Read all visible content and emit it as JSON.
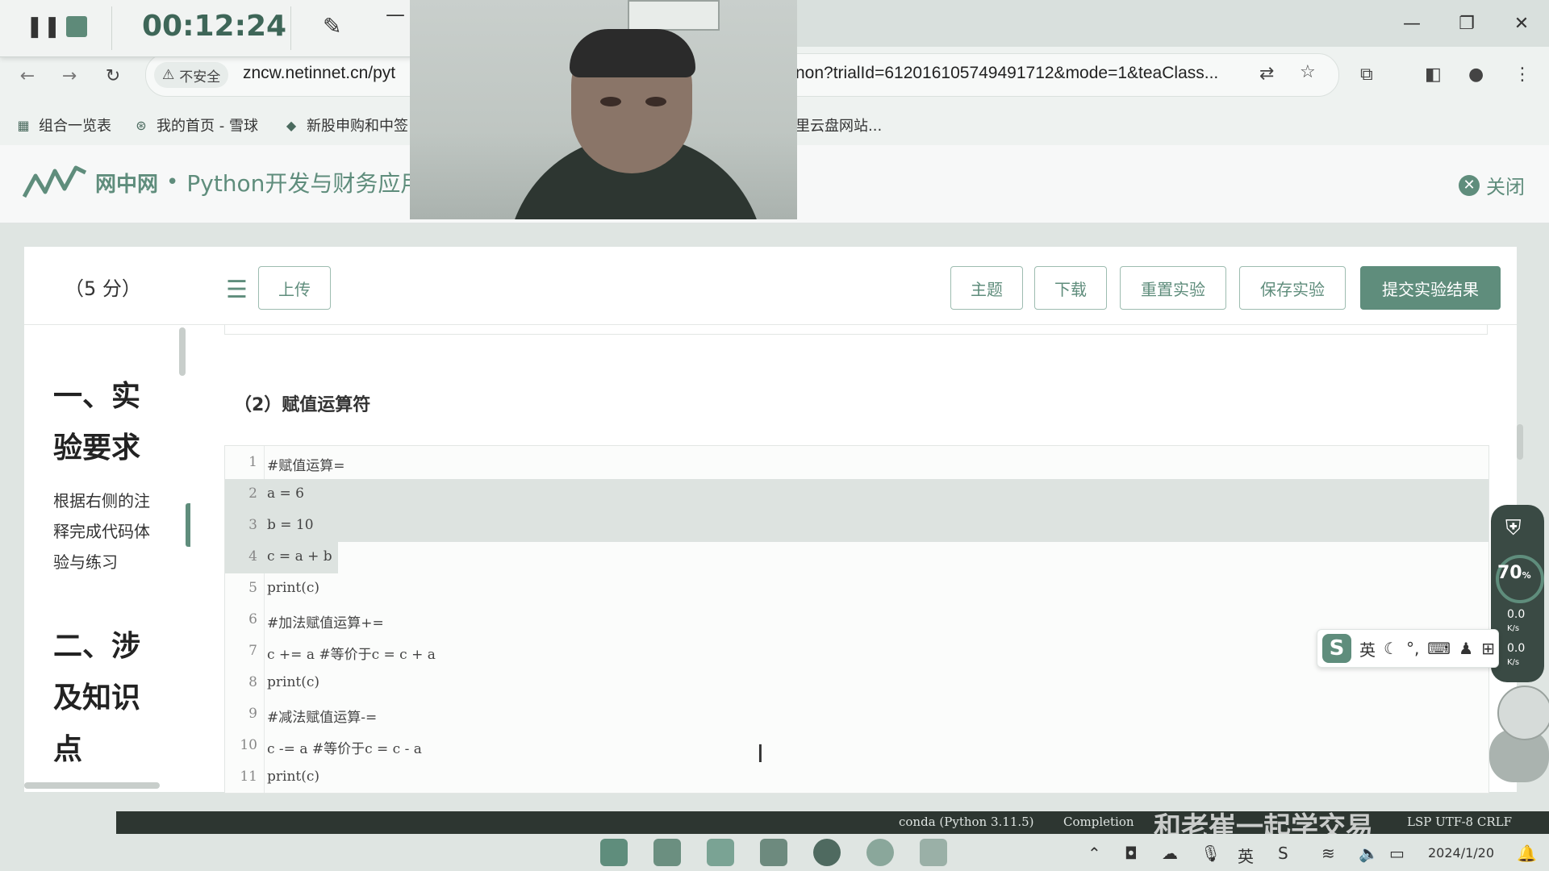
{
  "recorder": {
    "timer": "00:12:24"
  },
  "browser": {
    "security_label": "不安全",
    "url_visible_left": "zncw.netinnet.cn/pyt",
    "url_visible_right": "non?trialId=612016105749491712&mode=1&teaClass...",
    "bookmarks": [
      "组合一览表",
      "我的首页 - 雪球",
      "新股申购和中签",
      "里云盘网站..."
    ]
  },
  "app": {
    "brand": "网中网",
    "separator": "•",
    "course": "Python开发与财务应用",
    "close_label": "关闭"
  },
  "left_panel": {
    "score": "（5 分）",
    "heading1": "一、实验要求",
    "description": "根据右侧的注释完成代码体验与练习",
    "heading2": "二、涉及知识点"
  },
  "toolbar": {
    "upload": "上传",
    "theme": "主题",
    "download": "下载",
    "reset": "重置实验",
    "save": "保存实验",
    "submit": "提交实验结果"
  },
  "section_title": "（2）赋值运算符",
  "code_lines": [
    {
      "n": "1",
      "code": "#赋值运算="
    },
    {
      "n": "2",
      "code": "a = 6"
    },
    {
      "n": "3",
      "code": "b = 10"
    },
    {
      "n": "4",
      "code": "c = a + b"
    },
    {
      "n": "5",
      "code": "print(c)"
    },
    {
      "n": "6",
      "code": "#加法赋值运算+="
    },
    {
      "n": "7",
      "code": "c += a #等价于c = c + a"
    },
    {
      "n": "8",
      "code": "print(c)"
    },
    {
      "n": "9",
      "code": "#减法赋值运算-="
    },
    {
      "n": "10",
      "code": "c -= a #等价于c = c - a"
    },
    {
      "n": "11",
      "code": "print(c)"
    }
  ],
  "net_widget": {
    "percent": "70",
    "percent_unit": "%",
    "up": "0.0",
    "up_unit": "K/s",
    "down": "0.0",
    "down_unit": "K/s"
  },
  "ime": {
    "lang": "英"
  },
  "status": {
    "conda": "conda (Python 3.11.5)",
    "completion": "Completion",
    "rest": "LSP  UTF-8  CRLF"
  },
  "taskbar": {
    "date": "2024/1/20",
    "ime_tray": "英"
  },
  "watermark": "和老崔一起学交易"
}
